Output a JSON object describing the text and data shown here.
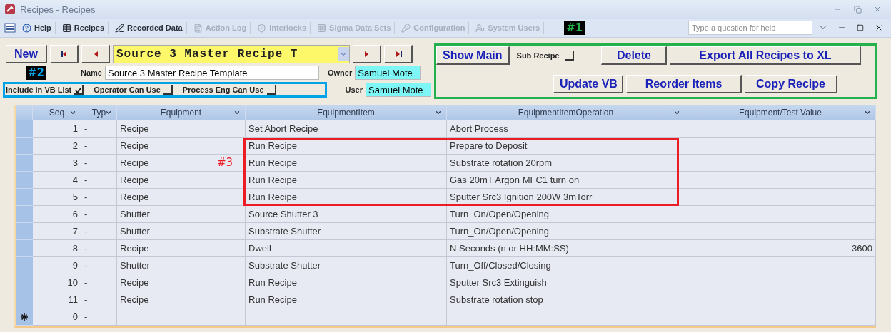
{
  "window": {
    "title": "Recipes - Recipes"
  },
  "toolbar": {
    "items": [
      {
        "label": "Help",
        "kind": "help",
        "disabled": false
      },
      {
        "label": "Recipes",
        "kind": "grid",
        "disabled": false
      },
      {
        "label": "Recorded Data",
        "kind": "pen",
        "disabled": false
      },
      {
        "label": "Action Log",
        "kind": "log",
        "disabled": true
      },
      {
        "label": "Interlocks",
        "kind": "interlock",
        "disabled": true
      },
      {
        "label": "Sigma Data Sets",
        "kind": "sheet",
        "disabled": true
      },
      {
        "label": "Configuration",
        "kind": "key",
        "disabled": true
      },
      {
        "label": "System Users",
        "kind": "user",
        "disabled": true
      }
    ],
    "help_search": {
      "placeholder": "Type a question for help"
    }
  },
  "annotations": [
    {
      "label": "#1",
      "color": "#22b14c",
      "badge": true
    },
    {
      "label": "#2",
      "color": "#00a2e8",
      "badge": true
    },
    {
      "label": "#3",
      "color": "#ed1c24",
      "badge": false
    }
  ],
  "form": {
    "new_button": "New",
    "recipe_select": {
      "value": "Source 3 Master Recipe T"
    },
    "show_main": "Show Main",
    "sub_recipe": {
      "label": "Sub Recipe",
      "checked": false
    },
    "delete": "Delete",
    "export": "Export All Recipes to XL",
    "name": {
      "label": "Name",
      "value": "Source 3 Master Recipe Template"
    },
    "owner": {
      "label": "Owner",
      "value": "Samuel Mote"
    },
    "user": {
      "label": "User",
      "value": "Samuel Mote"
    },
    "flags": [
      {
        "label": "Include in VB List",
        "checked": true
      },
      {
        "label": "Operator Can Use",
        "checked": false
      },
      {
        "label": "Process Eng Can Use",
        "checked": false
      }
    ],
    "update_vb": "Update VB",
    "reorder": "Reorder Items",
    "copy": "Copy Recipe"
  },
  "table": {
    "columns": [
      "Seq",
      "Typ",
      "Equipment",
      "EquipmentItem",
      "EquipmentItemOperation",
      "Equipment/Test Value"
    ],
    "rows": [
      {
        "kind": "record",
        "annotated": false,
        "cells": [
          "1",
          "-",
          "Recipe",
          "Set Abort Recipe",
          "Abort Process",
          ""
        ]
      },
      {
        "kind": "record",
        "annotated": true,
        "cells": [
          "2",
          "-",
          "Recipe",
          "Run Recipe",
          "Prepare to Deposit",
          ""
        ]
      },
      {
        "kind": "record",
        "annotated": true,
        "cells": [
          "3",
          "-",
          "Recipe",
          "Run Recipe",
          "Substrate rotation 20rpm",
          ""
        ]
      },
      {
        "kind": "record",
        "annotated": true,
        "cells": [
          "4",
          "-",
          "Recipe",
          "Run Recipe",
          "Gas 20mT Argon MFC1 turn on",
          ""
        ]
      },
      {
        "kind": "record",
        "annotated": true,
        "cells": [
          "5",
          "-",
          "Recipe",
          "Run Recipe",
          "Sputter Src3 Ignition 200W 3mTorr",
          ""
        ]
      },
      {
        "kind": "record",
        "annotated": false,
        "cells": [
          "6",
          "-",
          "Shutter",
          "Source Shutter 3",
          "Turn_On/Open/Opening",
          ""
        ]
      },
      {
        "kind": "record",
        "annotated": false,
        "cells": [
          "7",
          "-",
          "Shutter",
          "Substrate Shutter",
          "Turn_On/Open/Opening",
          ""
        ]
      },
      {
        "kind": "record",
        "annotated": false,
        "cells": [
          "8",
          "-",
          "Recipe",
          "Dwell",
          "N Seconds (n or HH:MM:SS)",
          "3600"
        ]
      },
      {
        "kind": "record",
        "annotated": false,
        "cells": [
          "9",
          "-",
          "Shutter",
          "Substrate Shutter",
          "Turn_Off/Closed/Closing",
          ""
        ]
      },
      {
        "kind": "record",
        "annotated": false,
        "cells": [
          "10",
          "-",
          "Recipe",
          "Run Recipe",
          "Sputter Src3 Extinguish",
          ""
        ]
      },
      {
        "kind": "record",
        "annotated": false,
        "cells": [
          "11",
          "-",
          "Recipe",
          "Run Recipe",
          "Substrate rotation stop",
          ""
        ]
      },
      {
        "kind": "new",
        "annotated": false,
        "cells": [
          "0",
          "-",
          "",
          "",
          "",
          ""
        ]
      }
    ]
  }
}
